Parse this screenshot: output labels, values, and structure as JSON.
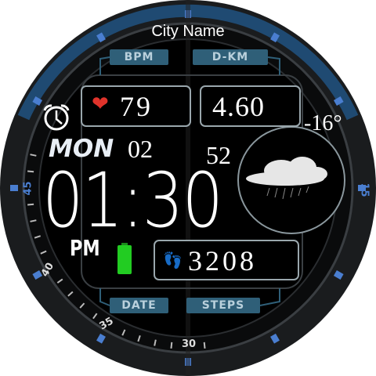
{
  "city": "City Name",
  "labels": {
    "bpm": "BPM",
    "dkm": "D-KM",
    "date": "DATE",
    "steps": "STEPS"
  },
  "heart_rate": "79",
  "distance_km": "4.60",
  "temperature": "-16°",
  "weekday": "MON",
  "day": "02",
  "seconds": "52",
  "time": "01:30",
  "ampm": "PM",
  "steps": "3208",
  "battery_level": 1.0,
  "weather_icon": "cloud-rain-icon",
  "bezel_numbers": {
    "n45": "45",
    "n40": "40",
    "n35": "35",
    "n30": "30",
    "n15": "15"
  },
  "colors": {
    "accent": "#2f5f78",
    "heart": "#e0332b",
    "battery": "#22cc22",
    "bezel_blue": "#2a5d8f"
  }
}
